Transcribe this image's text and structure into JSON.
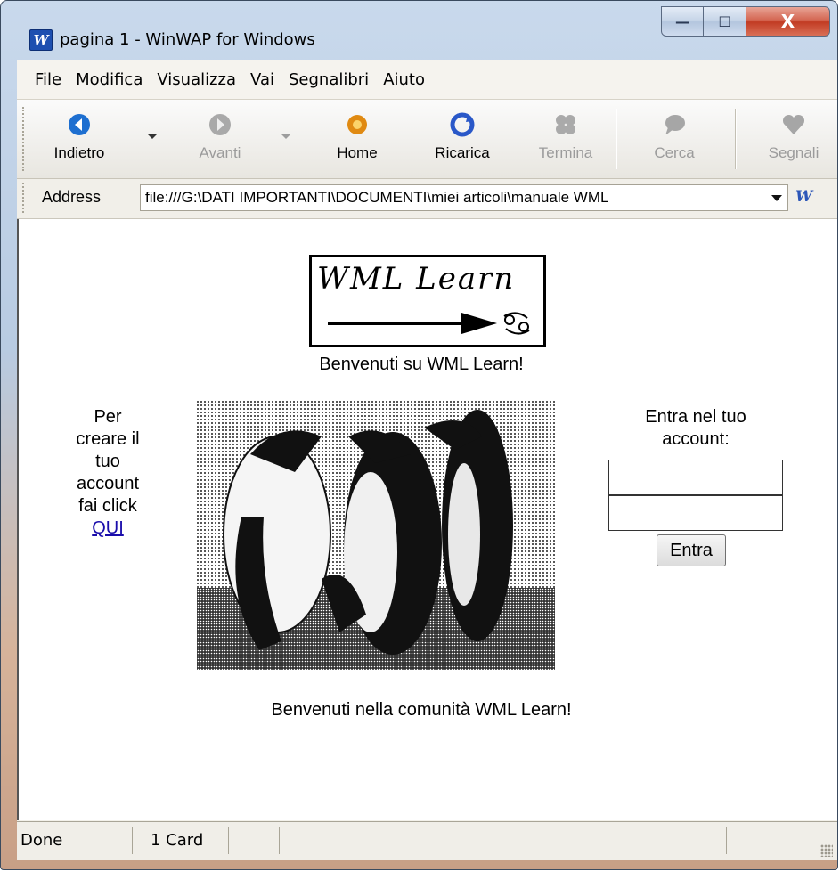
{
  "window": {
    "title": "pagina 1 - WinWAP for Windows",
    "app_icon_letter": "W",
    "controls": {
      "minimize": "—",
      "maximize": "☐",
      "close": "X"
    }
  },
  "menu": {
    "items": [
      {
        "label": "File"
      },
      {
        "label": "Modifica"
      },
      {
        "label": "Visualizza"
      },
      {
        "label": "Vai"
      },
      {
        "label": "Segnalibri"
      },
      {
        "label": "Aiuto"
      }
    ]
  },
  "toolbar": {
    "back": "Indietro",
    "forward": "Avanti",
    "home": "Home",
    "reload": "Ricarica",
    "stop": "Termina",
    "search": "Cerca",
    "bookmarks": "Segnali"
  },
  "address": {
    "label": "Address",
    "value": "file:///G:\\DATI IMPORTANTI\\DOCUMENTI\\miei articoli\\manuale WML",
    "logo": "W"
  },
  "page": {
    "logo_text": "WML Learn",
    "welcome_top": "Benvenuti su WML Learn!",
    "left_text": [
      "Per",
      "creare il",
      "tuo",
      "account",
      "fai click"
    ],
    "left_link": "QUI",
    "right_text": [
      "Entra nel tuo",
      "account:"
    ],
    "enter_button": "Entra",
    "welcome_bottom": "Benvenuti nella comunità WML Learn!"
  },
  "status": {
    "state": "Done",
    "cards": "1 Card"
  },
  "colors": {
    "link": "#1a0dab",
    "close_button": "#c13a22",
    "toolbar_icon_back": "#1e6fd0",
    "toolbar_icon_home": "#e08a12",
    "toolbar_icon_reload": "#2a58c8"
  }
}
